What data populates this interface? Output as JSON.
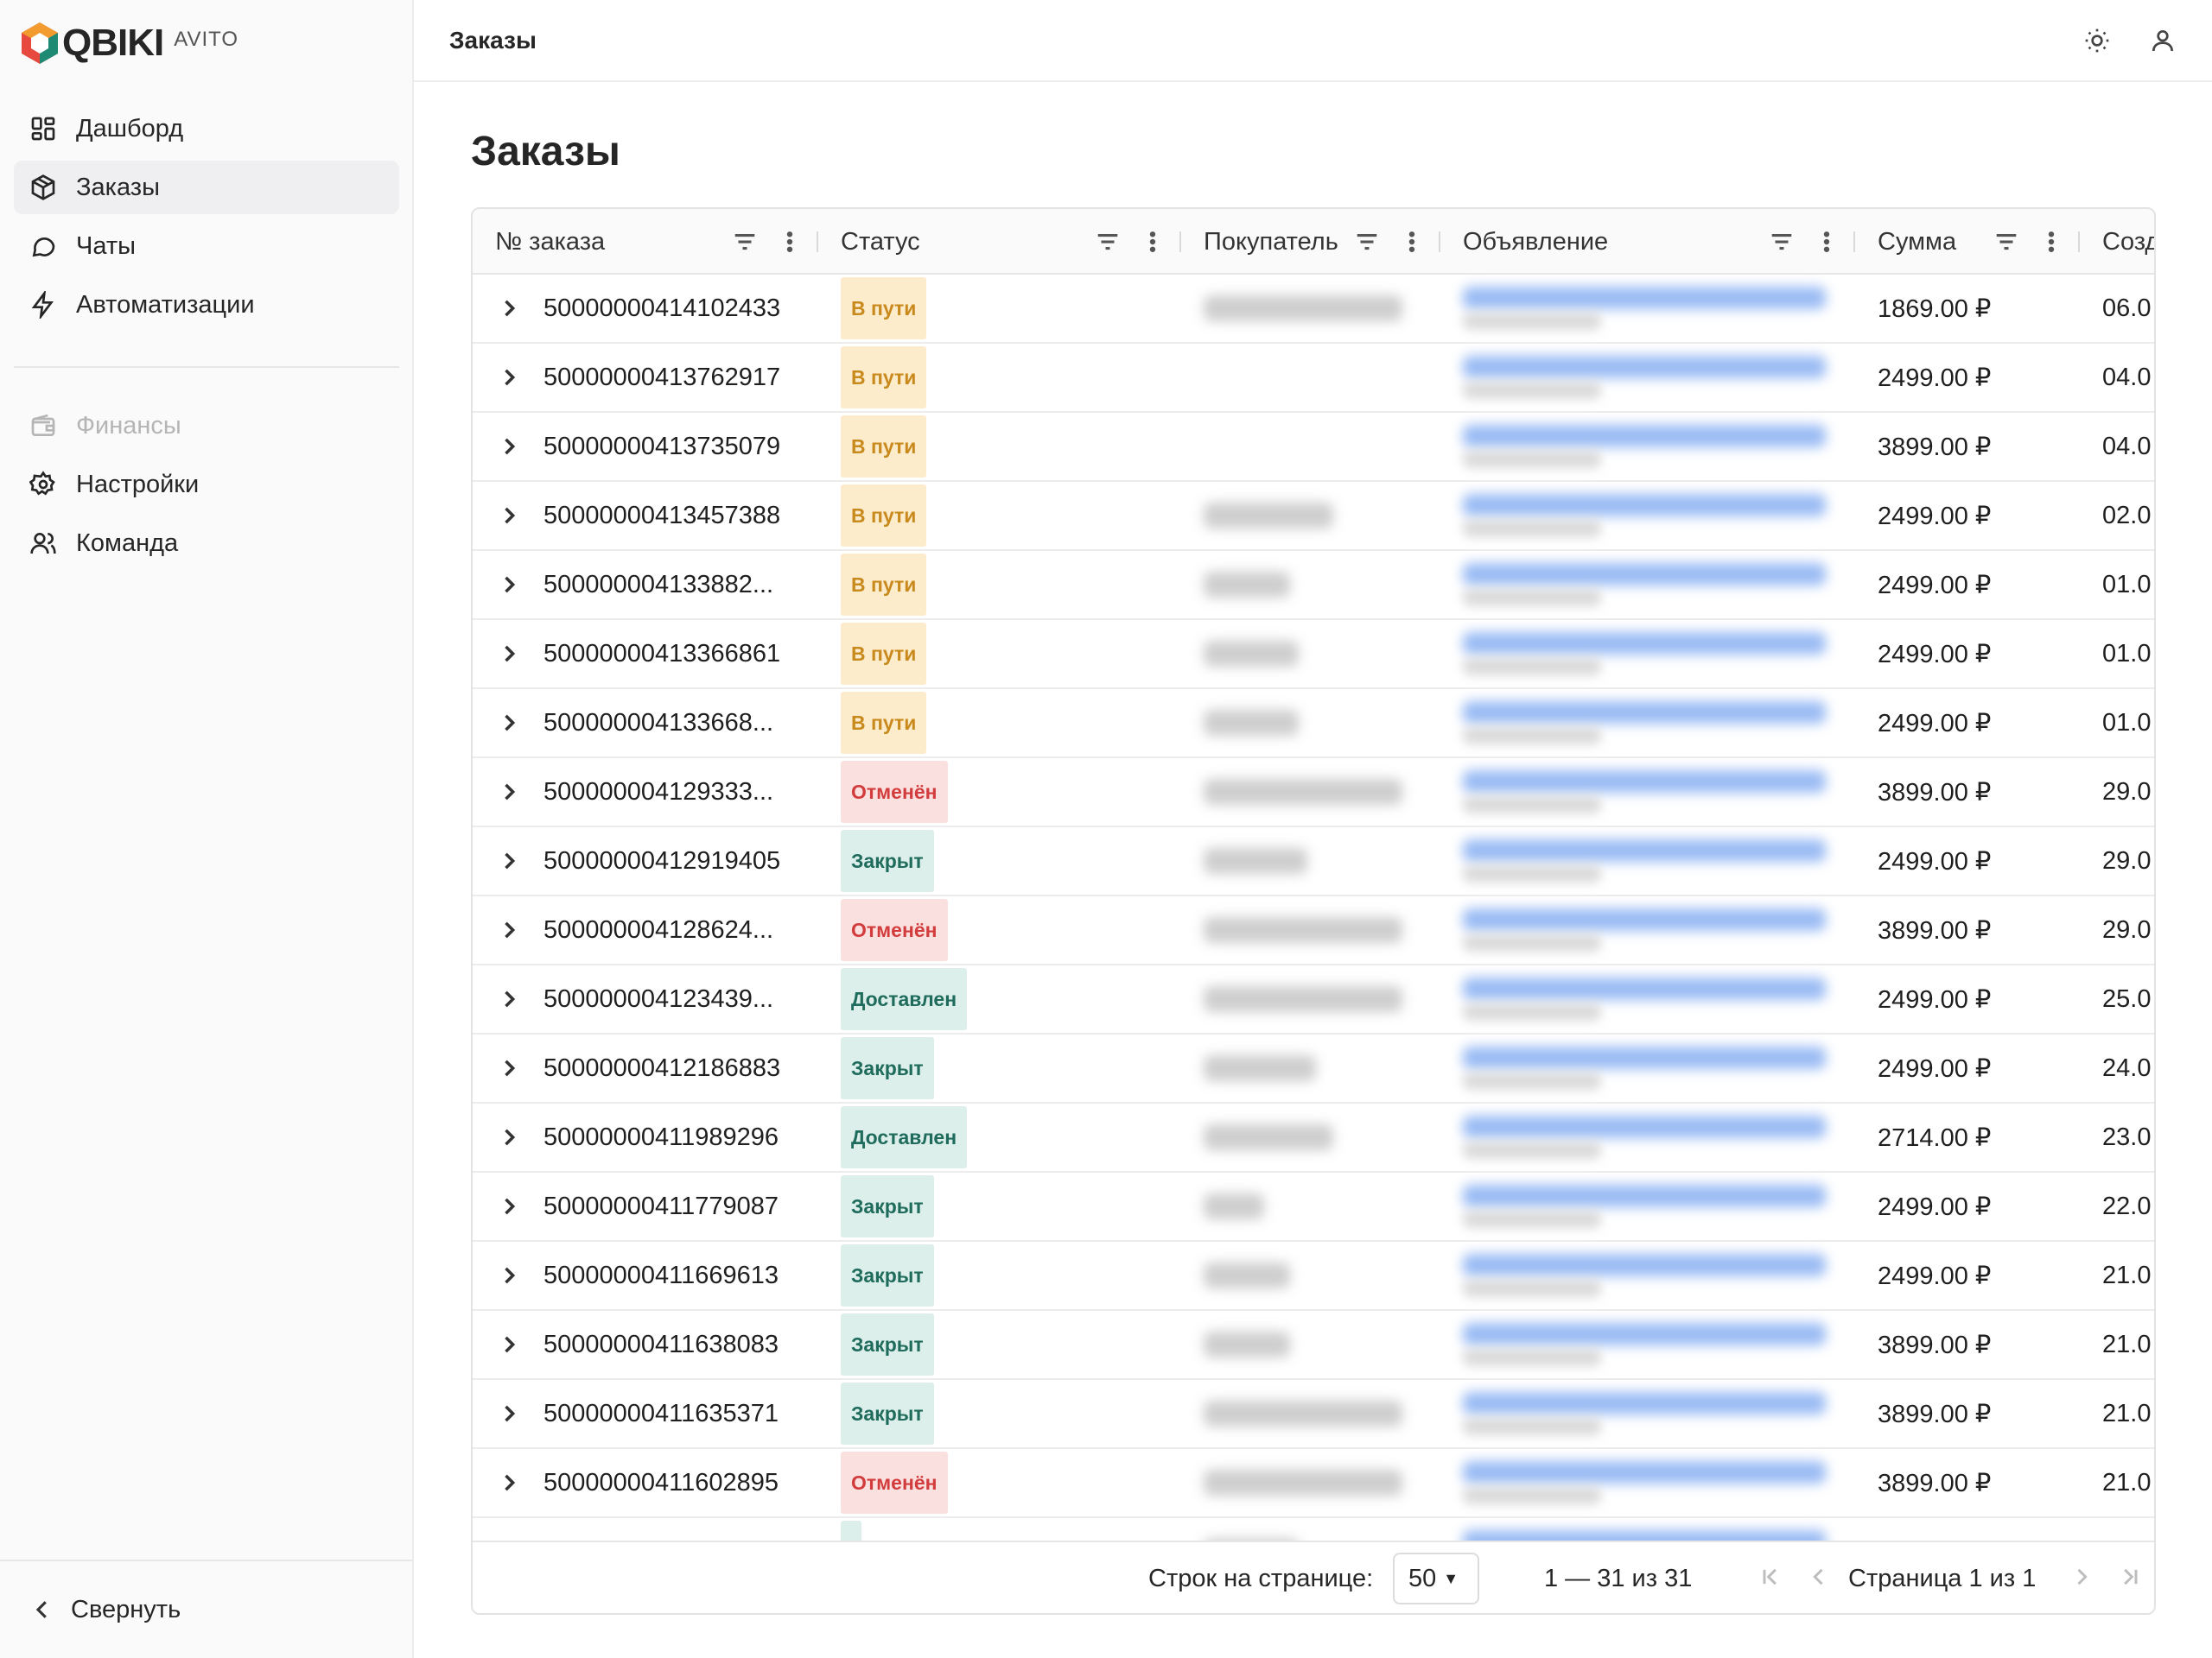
{
  "brand": {
    "name": "QBIKI",
    "sub": "AVITO"
  },
  "sidebar": {
    "items": [
      {
        "label": "Дашборд",
        "icon": "dashboard-icon",
        "active": false,
        "disabled": false
      },
      {
        "label": "Заказы",
        "icon": "box-icon",
        "active": true,
        "disabled": false
      },
      {
        "label": "Чаты",
        "icon": "chat-icon",
        "active": false,
        "disabled": false
      },
      {
        "label": "Автоматизации",
        "icon": "lightning-icon",
        "active": false,
        "disabled": false
      }
    ],
    "items2": [
      {
        "label": "Финансы",
        "icon": "wallet-icon",
        "active": false,
        "disabled": true
      },
      {
        "label": "Настройки",
        "icon": "gear-icon",
        "active": false,
        "disabled": false
      },
      {
        "label": "Команда",
        "icon": "users-icon",
        "active": false,
        "disabled": false
      }
    ],
    "collapse_label": "Свернуть"
  },
  "topbar": {
    "title": "Заказы",
    "icons": [
      "sun-icon",
      "user-icon"
    ]
  },
  "page": {
    "title": "Заказы"
  },
  "table": {
    "columns": [
      "№ заказа",
      "Статус",
      "Покупатель",
      "Объявление",
      "Сумма",
      "Созд"
    ],
    "rows": [
      {
        "id": "50000000414102433",
        "status": "В пути",
        "status_kind": "transit",
        "buyer": true,
        "sum": "1869.00 ₽",
        "created": "06.0"
      },
      {
        "id": "50000000413762917",
        "status": "В пути",
        "status_kind": "transit",
        "buyer": false,
        "sum": "2499.00 ₽",
        "created": "04.0"
      },
      {
        "id": "50000000413735079",
        "status": "В пути",
        "status_kind": "transit",
        "buyer": false,
        "sum": "3899.00 ₽",
        "created": "04.0"
      },
      {
        "id": "50000000413457388",
        "status": "В пути",
        "status_kind": "transit",
        "buyer": true,
        "sum": "2499.00 ₽",
        "created": "02.0"
      },
      {
        "id": "500000004133882...",
        "status": "В пути",
        "status_kind": "transit",
        "buyer": true,
        "sum": "2499.00 ₽",
        "created": "01.0"
      },
      {
        "id": "50000000413366861",
        "status": "В пути",
        "status_kind": "transit",
        "buyer": true,
        "sum": "2499.00 ₽",
        "created": "01.0"
      },
      {
        "id": "500000004133668...",
        "status": "В пути",
        "status_kind": "transit",
        "buyer": true,
        "sum": "2499.00 ₽",
        "created": "01.0"
      },
      {
        "id": "500000004129333...",
        "status": "Отменён",
        "status_kind": "cancel",
        "buyer": true,
        "sum": "3899.00 ₽",
        "created": "29.0"
      },
      {
        "id": "50000000412919405",
        "status": "Закрыт",
        "status_kind": "closed",
        "buyer": true,
        "sum": "2499.00 ₽",
        "created": "29.0"
      },
      {
        "id": "500000004128624...",
        "status": "Отменён",
        "status_kind": "cancel",
        "buyer": true,
        "sum": "3899.00 ₽",
        "created": "29.0"
      },
      {
        "id": "500000004123439...",
        "status": "Доставлен",
        "status_kind": "delivered",
        "buyer": true,
        "sum": "2499.00 ₽",
        "created": "25.0"
      },
      {
        "id": "50000000412186883",
        "status": "Закрыт",
        "status_kind": "closed",
        "buyer": true,
        "sum": "2499.00 ₽",
        "created": "24.0"
      },
      {
        "id": "50000000411989296",
        "status": "Доставлен",
        "status_kind": "delivered",
        "buyer": true,
        "sum": "2714.00 ₽",
        "created": "23.0"
      },
      {
        "id": "50000000411779087",
        "status": "Закрыт",
        "status_kind": "closed",
        "buyer": true,
        "sum": "2499.00 ₽",
        "created": "22.0"
      },
      {
        "id": "50000000411669613",
        "status": "Закрыт",
        "status_kind": "closed",
        "buyer": true,
        "sum": "2499.00 ₽",
        "created": "21.0"
      },
      {
        "id": "50000000411638083",
        "status": "Закрыт",
        "status_kind": "closed",
        "buyer": true,
        "sum": "3899.00 ₽",
        "created": "21.0"
      },
      {
        "id": "50000000411635371",
        "status": "Закрыт",
        "status_kind": "closed",
        "buyer": true,
        "sum": "3899.00 ₽",
        "created": "21.0"
      },
      {
        "id": "50000000411602895",
        "status": "Отменён",
        "status_kind": "cancel",
        "buyer": true,
        "sum": "3899.00 ₽",
        "created": "21.0"
      },
      {
        "id": "",
        "status": "",
        "status_kind": "delivered",
        "buyer": true,
        "sum": "",
        "created": ""
      }
    ]
  },
  "footer": {
    "rows_per_page_label": "Строк на странице:",
    "rows_per_page_value": "50",
    "range": "1 — 31 из 31",
    "page": "Страница 1 из 1"
  }
}
